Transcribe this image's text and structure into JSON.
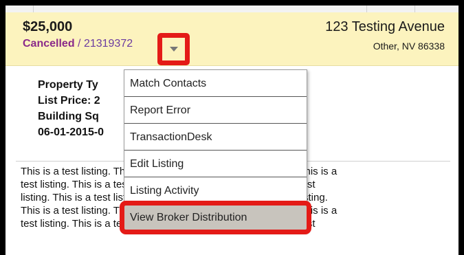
{
  "listing": {
    "price": "$25,000",
    "status": "Cancelled",
    "separator": " / ",
    "mls_number": "21319372",
    "address": "123 Testing Avenue",
    "city_state_zip": "Other, NV 86338",
    "details": {
      "property_type": "Property Ty",
      "list_price": "List Price: 2",
      "building_sqft": "Building Sq",
      "date_range": "06-01-2015-0"
    },
    "description_lines": [
      "This is a test listing. This is a test listing. This is a test listing. This is a",
      "test listing. This is a test listing. This is a test listing. This is a test",
      "listing. This is a test listing. This is a test listing. This is a test listing.",
      "This is a test listing. This is a test listing. This is a test listing. This is a",
      "test listing. This is a test listing. This is a test listing. This is a test"
    ]
  },
  "menu": {
    "items": [
      "Match Contacts",
      "Report Error",
      "TransactionDesk",
      "Edit Listing",
      "Listing Activity",
      "View Broker Distribution"
    ]
  },
  "colors": {
    "header_bg": "#fcf3be",
    "status": "#8a2a8a",
    "highlight_outline": "#e41b17",
    "highlight_item_bg": "#c8c4bd"
  },
  "icons": {
    "dropdown": "caret-down-icon"
  }
}
